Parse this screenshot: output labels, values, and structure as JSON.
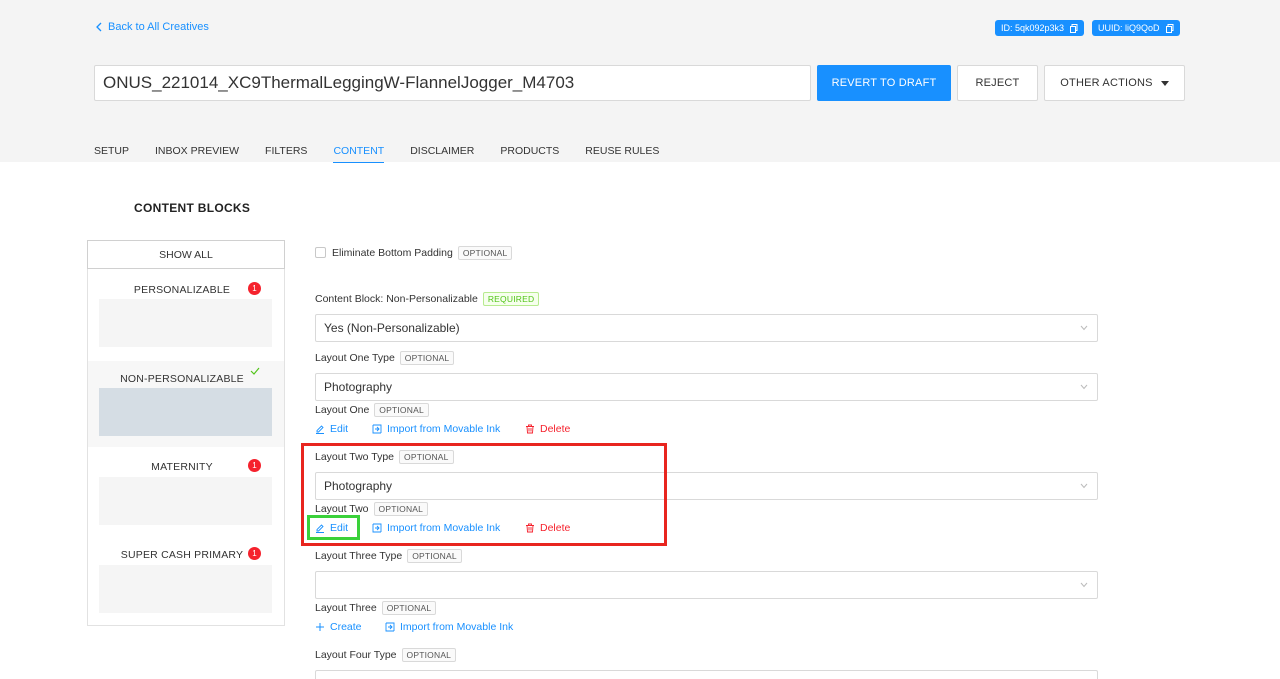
{
  "header": {
    "back_label": "Back to All Creatives",
    "id_badge": "ID: 5qk092p3k3",
    "uuid_badge": "UUID: liQ9QoD",
    "title": "ONUS_221014_XC9ThermalLeggingW-FlannelJogger_M4703",
    "revert_label": "REVERT TO DRAFT",
    "reject_label": "REJECT",
    "other_label": "OTHER ACTIONS"
  },
  "tabs": [
    "SETUP",
    "INBOX PREVIEW",
    "FILTERS",
    "CONTENT",
    "DISCLAIMER",
    "PRODUCTS",
    "REUSE RULES"
  ],
  "active_tab": "CONTENT",
  "sidebar": {
    "title": "CONTENT BLOCKS",
    "show_all": "SHOW ALL",
    "items": [
      {
        "label": "PERSONALIZABLE",
        "badge": "1"
      },
      {
        "label": "NON-PERSONALIZABLE",
        "status": "check-icon"
      },
      {
        "label": "MATERNITY",
        "badge": "1"
      },
      {
        "label": "SUPER CASH PRIMARY",
        "badge": "1"
      }
    ]
  },
  "form": {
    "eliminate_label": "Eliminate Bottom Padding",
    "optional": "OPTIONAL",
    "required": "REQUIRED",
    "content_block_label": "Content Block: Non-Personalizable",
    "content_block_value": "Yes (Non-Personalizable)",
    "layout_one_type_label": "Layout One Type",
    "layout_one_type_value": "Photography",
    "layout_one_label": "Layout One",
    "layout_two_type_label": "Layout Two Type",
    "layout_two_type_value": "Photography",
    "layout_two_label": "Layout Two",
    "layout_three_type_label": "Layout Three Type",
    "layout_three_type_value": "",
    "layout_three_label": "Layout Three",
    "layout_four_type_label": "Layout Four Type",
    "edit": "Edit",
    "create": "Create",
    "import": "Import from Movable Ink",
    "delete": "Delete"
  },
  "colors": {
    "accent": "#1890ff",
    "danger": "#f5222d",
    "success": "#52c41a",
    "highlight_red": "#e8251f",
    "highlight_green": "#3ad13a"
  }
}
